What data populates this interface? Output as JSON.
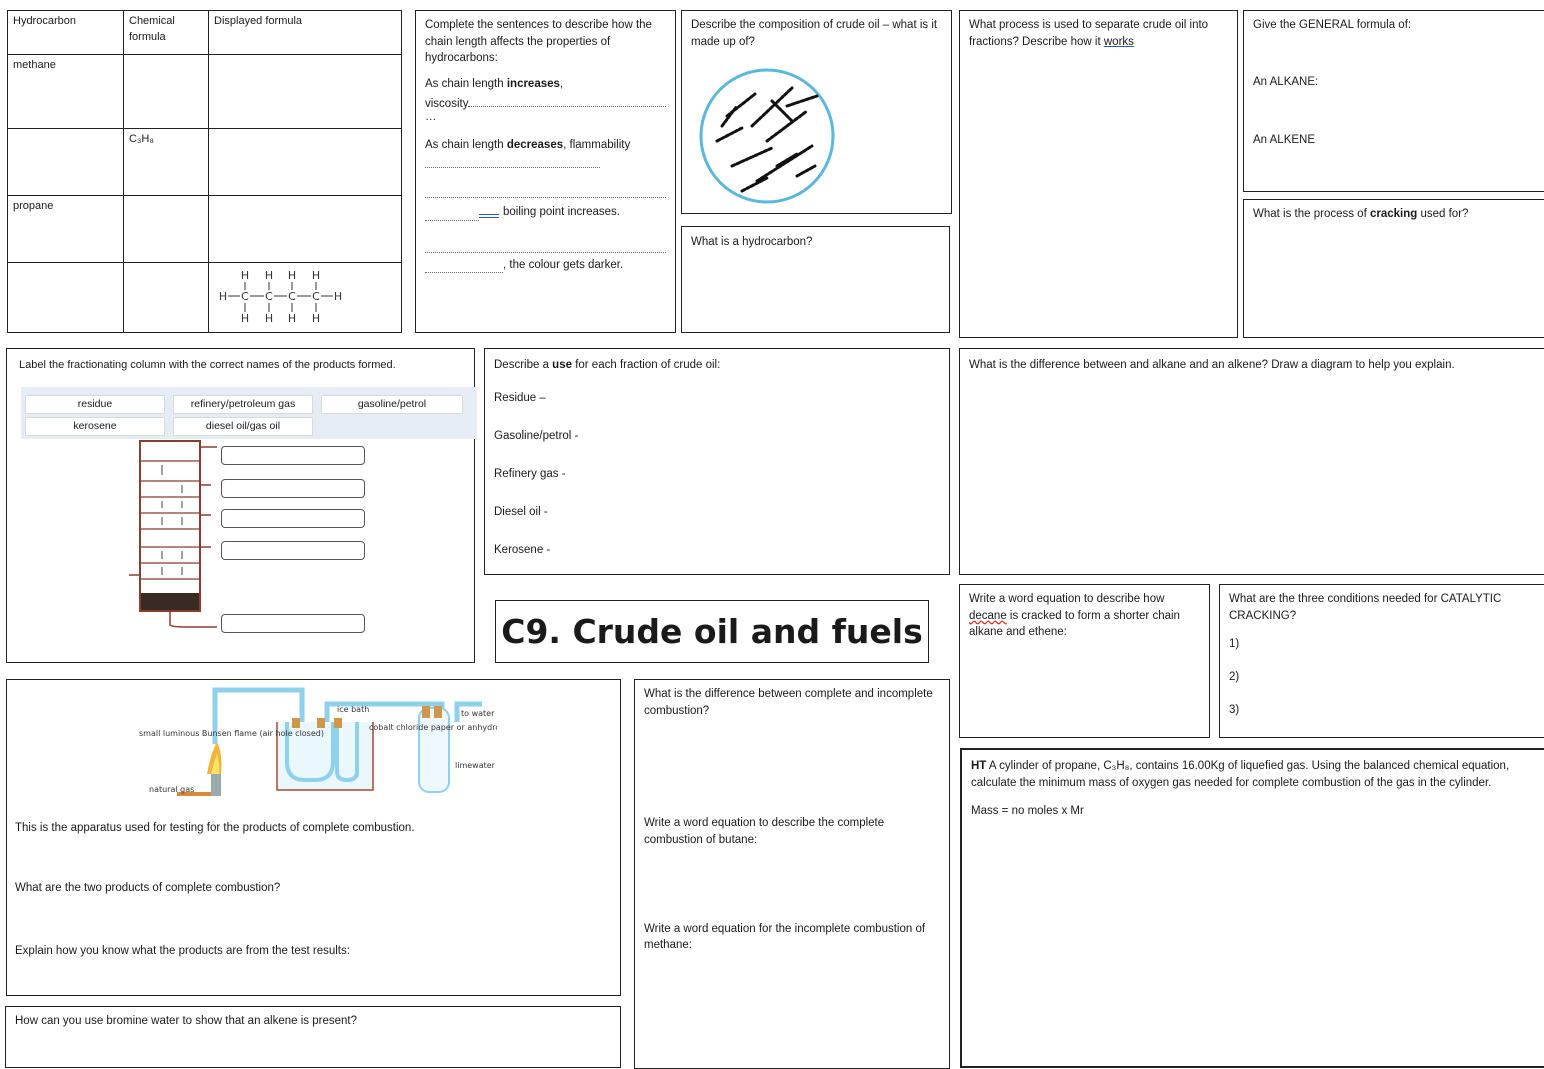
{
  "table": {
    "headers": [
      "Hydrocarbon",
      "Chemical formula",
      "Displayed formula"
    ],
    "rows": [
      {
        "name": "methane",
        "formula": ""
      },
      {
        "name": "",
        "formula": "C₃H₈"
      },
      {
        "name": "propane",
        "formula": ""
      },
      {
        "name": "",
        "formula": ""
      }
    ],
    "butane_H": "H",
    "butane_C": "C"
  },
  "chain": {
    "intro": "Complete the sentences to describe how the chain length affects the properties of hydrocarbons:",
    "s1_pre": "As chain length ",
    "s1_bold": "increases",
    "s1_post": ",",
    "s1_line": "viscosity",
    "s1_tail": "…",
    "s2_pre": "As chain length ",
    "s2_bold": "decreases",
    "s2_post": ", flammability",
    "s3": "boiling point increases.",
    "s4": ", the colour gets darker."
  },
  "composition": {
    "question": "Describe the composition of crude oil – what is it made up of?"
  },
  "hydrocarbon": {
    "question": "What is a hydrocarbon?"
  },
  "process": {
    "question_pre": "What process is used to separate crude oil into fractions? Describe how it ",
    "question_link": "works"
  },
  "general": {
    "question": "Give the GENERAL formula of:",
    "alkane": "An ALKANE:",
    "alkene": "An ALKENE"
  },
  "cracking": {
    "q_pre": "What is the process of ",
    "q_bold": "cracking",
    "q_post": " used for?"
  },
  "column": {
    "instruction": "Label the fractionating column with the correct names of the products formed.",
    "labels": [
      "residue",
      "refinery/petroleum gas",
      "gasoline/petrol",
      "kerosene",
      "diesel oil/gas oil"
    ]
  },
  "uses": {
    "q_pre": "Describe a ",
    "q_bold": "use",
    "q_post": " for each fraction of crude oil:",
    "items": [
      "Residue –",
      "Gasoline/petrol -",
      "Refinery gas -",
      "Diesel oil -",
      "Kerosene -"
    ]
  },
  "alkane_alkene": {
    "question": "What is the difference between and alkane and an alkene?  Draw a diagram to help you explain."
  },
  "title": "C9. Crude oil and fuels",
  "decane": {
    "q_pre": "Write a word equation to describe how ",
    "q_word": "decane",
    "q_post": " is cracked to form a shorter chain alkane and ethene:"
  },
  "conditions": {
    "question": "What are the three conditions needed for CATALYTIC CRACKING?",
    "n1": "1)",
    "n2": "2)",
    "n3": "3)"
  },
  "apparatus": {
    "labels": {
      "flame": "small luminous Bunsen flame (air hole closed)",
      "gas": "natural gas",
      "ice": "ice bath",
      "cobalt": "cobalt chloride paper or anhydrous copper sulfate powder",
      "pump": "to water pump",
      "limewater": "limewater"
    },
    "caption": "This is the apparatus used for testing for the products of complete combustion.",
    "q1": "What are the two products of complete combustion?",
    "q2": "Explain how you know what the products are from the test results:"
  },
  "combustion": {
    "q1": "What is the difference between complete and incomplete combustion?",
    "q2": "Write a word equation to describe the complete combustion of butane:",
    "q3": "Write a word equation for the incomplete combustion of methane:"
  },
  "ht": {
    "tag": "HT",
    "text": " A cylinder of propane, C₃H₈, contains 16.00Kg of liquefied gas. Using the balanced chemical equation, calculate the minimum mass of oxygen gas needed for complete combustion of the gas in the cylinder.",
    "formula": "Mass = no moles x Mr"
  },
  "bromine": {
    "question": "How can you use bromine water to show that an alkene is present?"
  }
}
